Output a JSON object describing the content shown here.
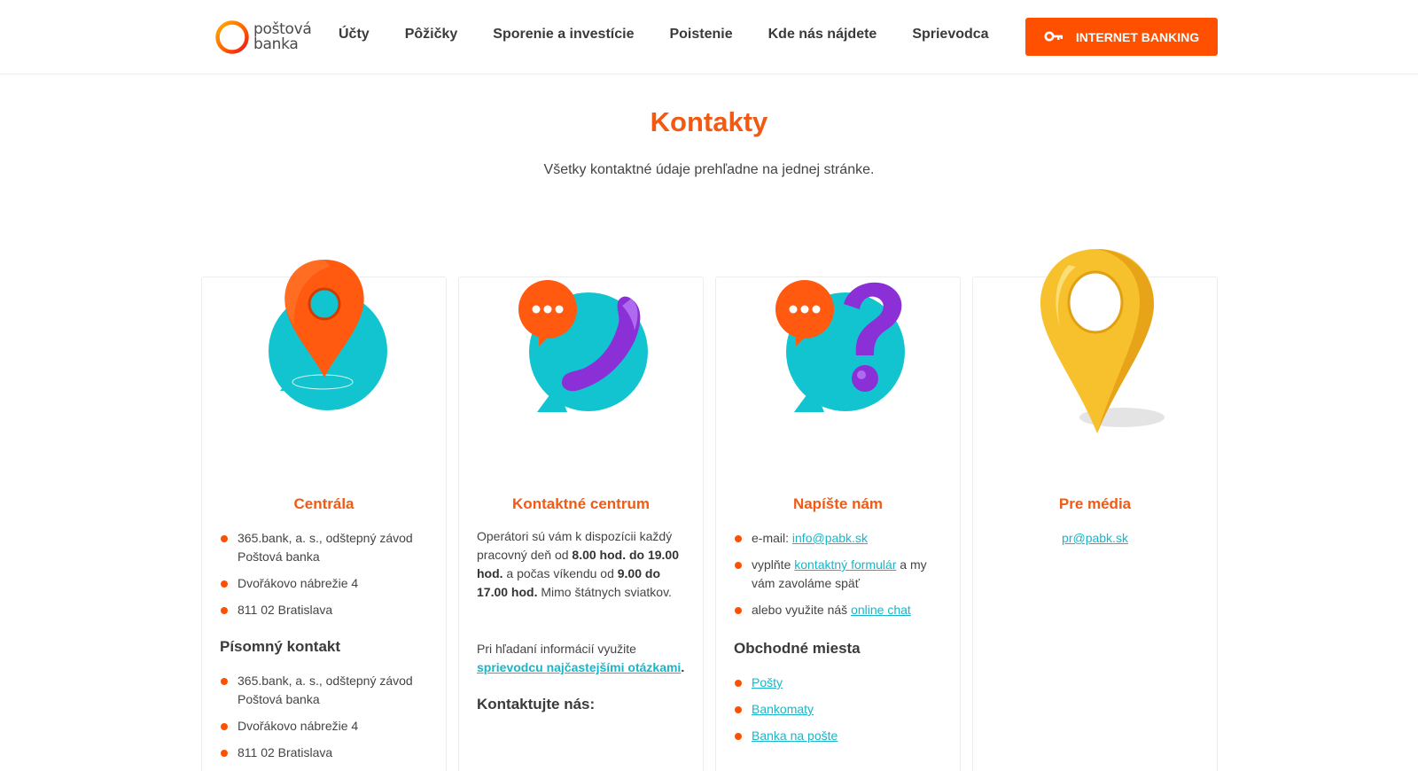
{
  "header": {
    "logo": {
      "line1": "poštová",
      "line2": "banka"
    },
    "nav": [
      "Účty",
      "Pôžičky",
      "Sporenie a investície",
      "Poistenie",
      "Kde nás nájdete",
      "Sprievodca"
    ],
    "internet_banking": "INTERNET BANKING"
  },
  "page": {
    "title": "Kontakty",
    "subtitle": "Všetky kontaktné údaje prehľadne na jednej stránke."
  },
  "cards": {
    "centrala": {
      "title": "Centrála",
      "items": [
        "365.bank, a. s., odštepný závod Poštová banka",
        "Dvořákovo nábrežie 4",
        "811 02 Bratislava"
      ],
      "sub_title": "Písomný kontakt",
      "sub_items": [
        "365.bank, a. s., odštepný závod Poštová banka",
        "Dvořákovo nábrežie 4",
        "811 02 Bratislava"
      ]
    },
    "kontaktne_centrum": {
      "title": "Kontaktné centrum",
      "p1_a": "Operátori sú vám k dispozícii každý pracovný deň od ",
      "p1_b": "8.00 hod. do 19.00 hod.",
      "p1_c": " a počas víkendu od ",
      "p1_d": "9.00 do 17.00 hod.",
      "p1_e": " Mimo štátnych sviatkov.",
      "p2_a": "Pri hľadaní informácií využite ",
      "p2_link": "sprievodcu najčastejšími otázkami",
      "p2_end": ".",
      "sub_title": "Kontaktujte nás:"
    },
    "napiste_nam": {
      "title": "Napíšte nám",
      "email_label": "e-mail: ",
      "email": "info@pabk.sk",
      "form_a": "vyplňte ",
      "form_link": "kontaktný formulár",
      "form_b": " a my vám zavoláme späť",
      "chat_a": "alebo využite náš ",
      "chat_link": "online chat",
      "sub_title": "Obchodné miesta",
      "places": [
        "Pošty",
        "Bankomaty",
        "Banka na pošte"
      ]
    },
    "pre_media": {
      "title": "Pre média",
      "email": "pr@pabk.sk"
    }
  },
  "colors": {
    "accent": "#ff5000",
    "title": "#f25a13",
    "link": "#18b6c8",
    "teal": "#12c4cf",
    "purple": "#8b2fd6",
    "gold": "#f6c12c"
  }
}
